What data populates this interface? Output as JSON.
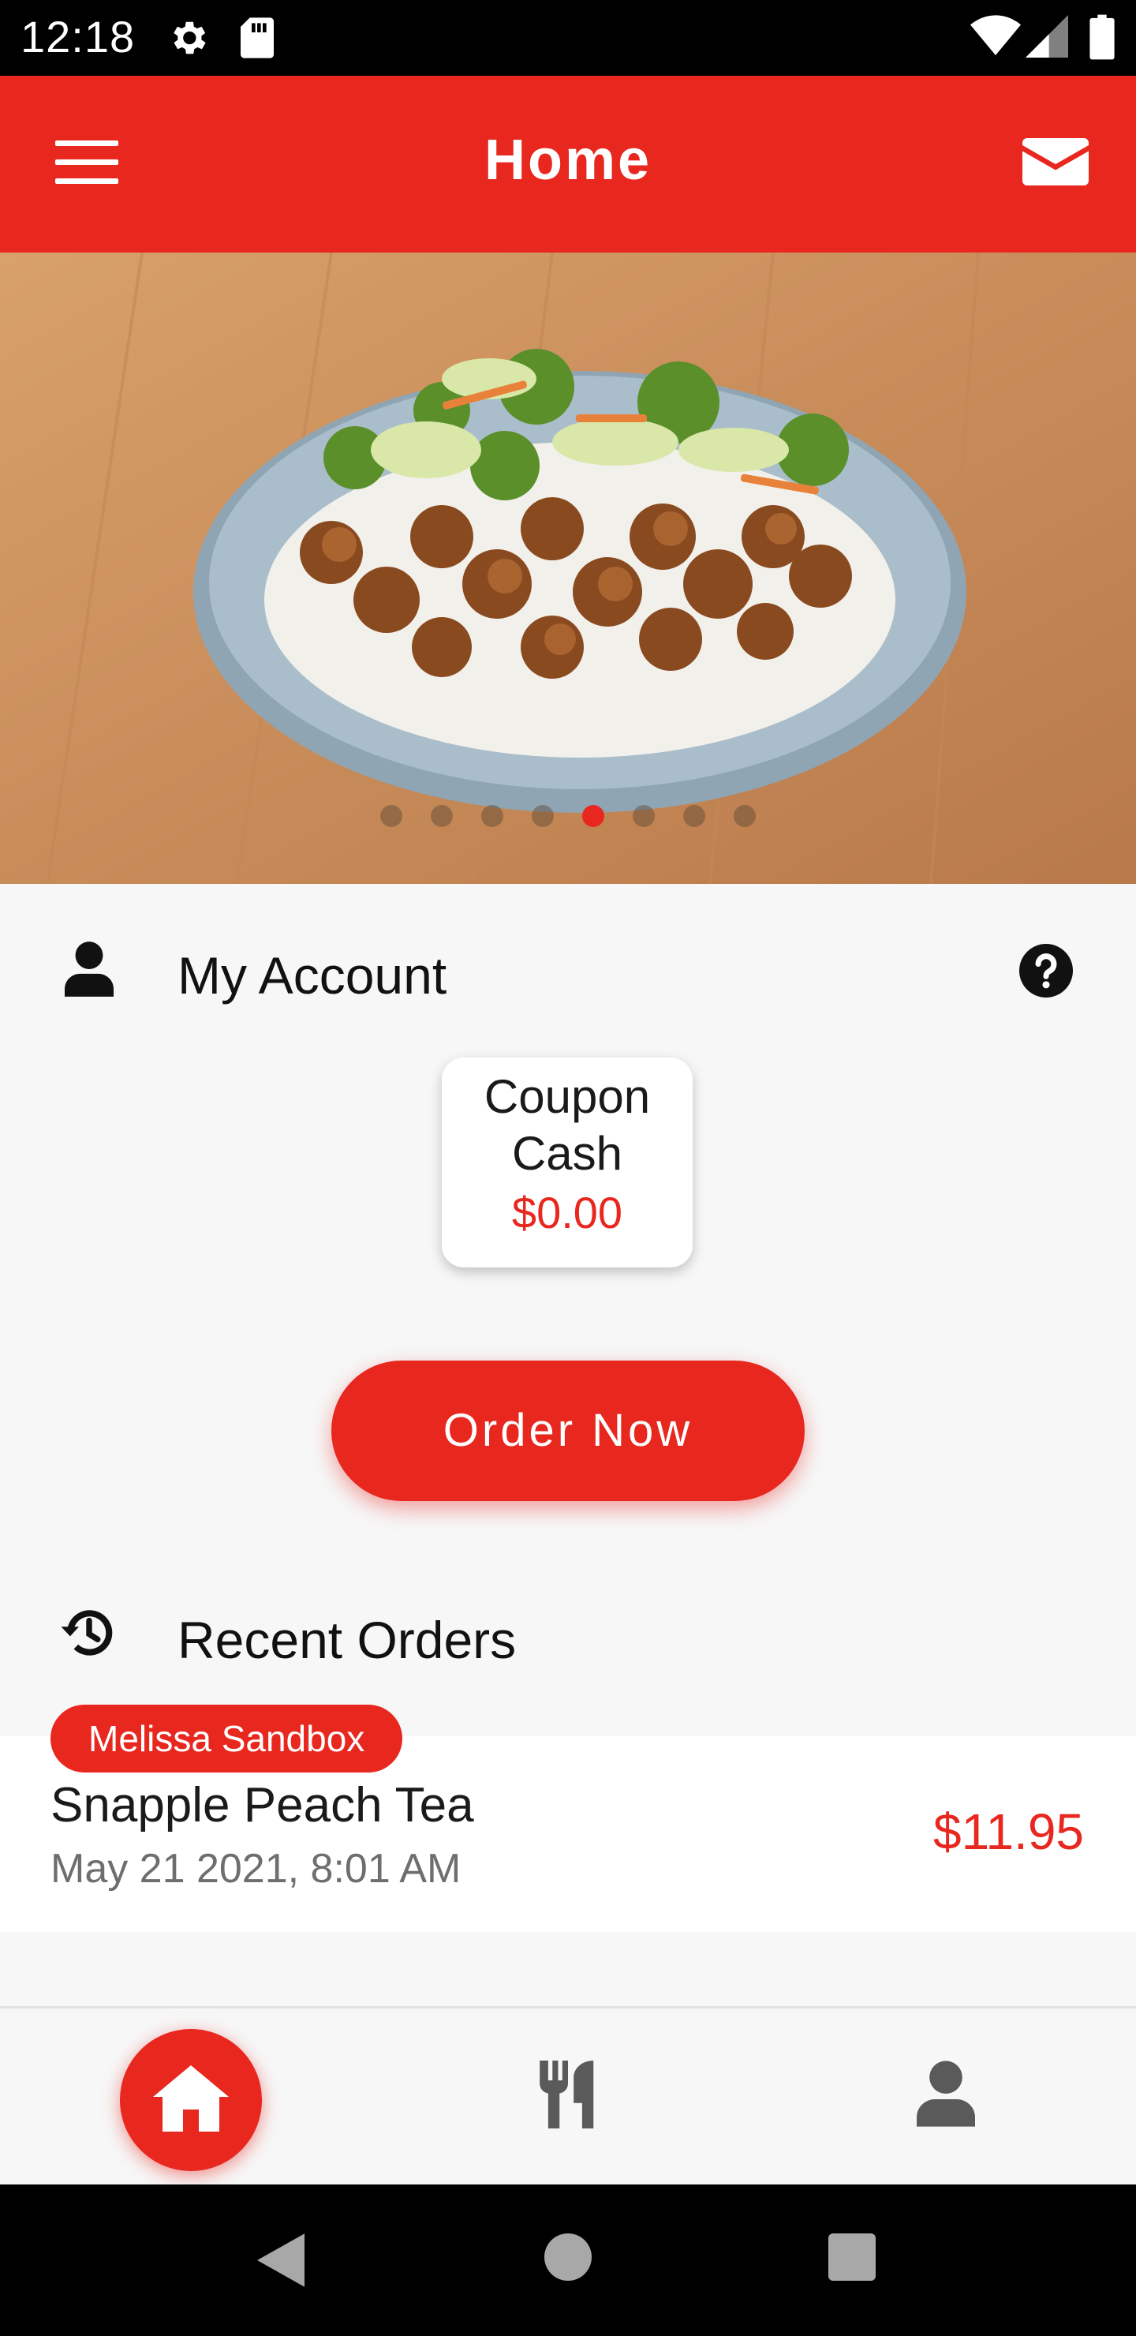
{
  "status_bar": {
    "time": "12:18"
  },
  "app_bar": {
    "title": "Home"
  },
  "hero": {
    "carousel_page_count": 8,
    "carousel_active_index": 4
  },
  "account": {
    "title": "My Account",
    "coupon_label_line1": "Coupon",
    "coupon_label_line2": "Cash",
    "coupon_value": "$0.00"
  },
  "order_now_label": "Order Now",
  "recent_orders": {
    "title": "Recent Orders",
    "items": [
      {
        "store": "Melissa Sandbox",
        "item": "Snapple Peach Tea",
        "date": "May 21 2021, 8:01 AM",
        "price": "$11.95"
      }
    ]
  },
  "bottom_nav": {
    "items": [
      "home-icon",
      "utensils-icon",
      "user-icon"
    ],
    "active": "home-icon"
  },
  "colors": {
    "accent": "#e8271f",
    "background": "#f7f7f7",
    "text": "#1a1a1a",
    "muted": "#6e6e6e"
  }
}
